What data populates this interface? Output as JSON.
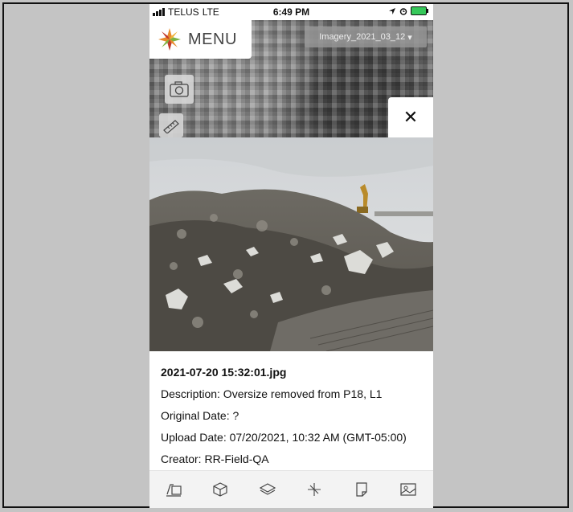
{
  "status_bar": {
    "carrier": "TELUS",
    "network": "LTE",
    "time": "6:49 PM"
  },
  "header": {
    "menu_label": "MENU",
    "imagery_selected": "Imagery_2021_03_12",
    "dropdown_caret": "▾"
  },
  "close_glyph": "✕",
  "photo_info": {
    "filename": "2021-07-20 15:32:01.jpg",
    "description": "Description: Oversize removed from P18, L1",
    "original_date": "Original Date: ?",
    "upload_date": "Upload Date: 07/20/2021, 10:32 AM (GMT-05:00)",
    "creator": "Creator: RR-Field-QA"
  },
  "toolbar": {
    "items": [
      "survey-icon",
      "cube-icon",
      "layers-icon",
      "sparkle-icon",
      "page-icon",
      "image-icon"
    ]
  },
  "colors": {
    "background": "#c4c4c4",
    "battery_charging": "#36c85a",
    "logo_orange": "#e8892b",
    "logo_green": "#7cb342",
    "logo_red": "#c0392b"
  }
}
